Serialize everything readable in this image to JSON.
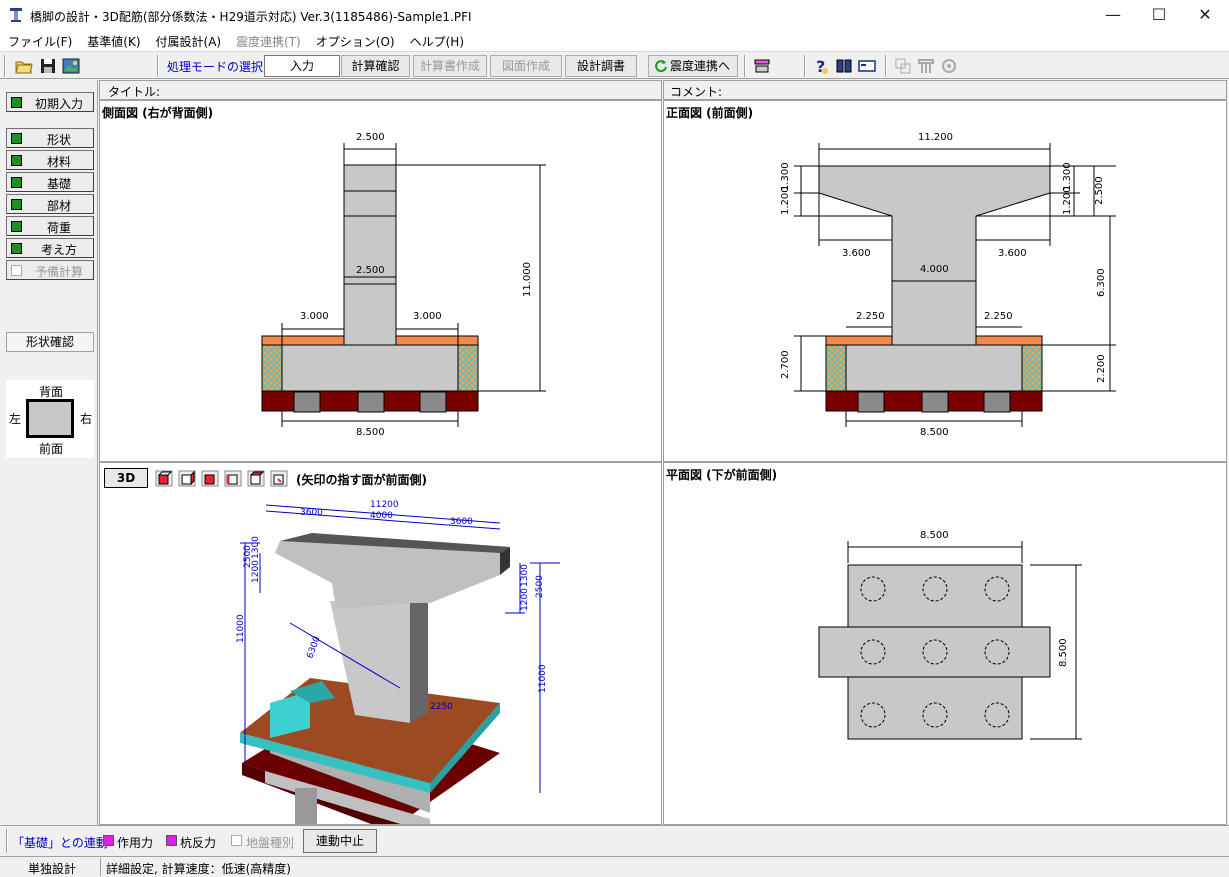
{
  "window": {
    "title": "橋脚の設計・3D配筋(部分係数法・H29道示対応) Ver.3(1185486)-Sample1.PFI",
    "minimize": "—",
    "maximize": "☐",
    "close": "✕"
  },
  "menu": [
    {
      "label": "ファイル(F)",
      "enabled": true
    },
    {
      "label": "基準値(K)",
      "enabled": true
    },
    {
      "label": "付属設計(A)",
      "enabled": true
    },
    {
      "label": "震度連携(T)",
      "enabled": false
    },
    {
      "label": "オプション(O)",
      "enabled": true
    },
    {
      "label": "ヘルプ(H)",
      "enabled": true
    }
  ],
  "toolbar": {
    "mode_label": "処理モードの選択",
    "input": "入力",
    "calc_check": "計算確認",
    "calc_doc": "計算書作成",
    "drawing": "図面作成",
    "design_doc": "設計調書",
    "seismic_link": "震度連携へ"
  },
  "sidebar": {
    "items": [
      {
        "label": "初期入力",
        "checked": true,
        "enabled": true
      },
      {
        "label": "形状",
        "checked": true,
        "enabled": true
      },
      {
        "label": "材料",
        "checked": true,
        "enabled": true
      },
      {
        "label": "基礎",
        "checked": true,
        "enabled": true
      },
      {
        "label": "部材",
        "checked": true,
        "enabled": true
      },
      {
        "label": "荷重",
        "checked": true,
        "enabled": true
      },
      {
        "label": "考え方",
        "checked": true,
        "enabled": true
      },
      {
        "label": "予備計算",
        "checked": false,
        "enabled": false
      }
    ],
    "shape_check": "形状確認",
    "orient": {
      "back": "背面",
      "left": "左",
      "right": "右",
      "front": "前面"
    }
  },
  "header": {
    "title_label": "タイトル:",
    "comment_label": "コメント:"
  },
  "side_view": {
    "title": "側面図 (右が背面側)",
    "dims": {
      "top_width": "2.500",
      "col_width": "2.500",
      "left": "3.000",
      "right": "3.000",
      "base": "8.500",
      "height": "11.000"
    }
  },
  "front_view": {
    "title": "正面図 (前面側)",
    "dims": {
      "beam": "11.200",
      "h1": "1.300",
      "h2": "1.200",
      "h3": "2.500",
      "cant_l": "3.600",
      "cant_r": "3.600",
      "col": "4.000",
      "col_h": "6.300",
      "ftg_l": "2.250",
      "ftg_r": "2.250",
      "ftg_h1": "2.700",
      "ftg_h2": "2.200",
      "base": "8.500",
      "h1r": "1.300",
      "h2r": "1.200"
    }
  },
  "view3d": {
    "button": "3D",
    "caption": "(矢印の指す面が前面側)",
    "dims": {
      "total": "11200",
      "l": "3600",
      "m": "4000",
      "r": "3600",
      "h1": "1300",
      "h2": "1200",
      "h3": "2500",
      "hl1": "2500",
      "hl2": "1200",
      "hl3": "1300",
      "total_h": "11000",
      "col_h": "11000",
      "c1": "6300",
      "c2": "2250"
    }
  },
  "plan_view": {
    "title": "平面図 (下が前面側)",
    "dims": {
      "width": "8.500",
      "depth": "8.500"
    }
  },
  "link_bar": {
    "label": "「基礎」との連動",
    "force": "作用力",
    "pile": "杭反力",
    "ground": "地盤種別",
    "stop": "連動中止"
  },
  "status": {
    "mode": "単独設計",
    "detail": "詳細設定, 計算速度：低速(高精度)"
  },
  "colors": {
    "concrete": "#c8c8c8",
    "footing_top": "#f28a4e",
    "base_slab": "#7a0000",
    "hatch": "#40c8c8",
    "dim": "#000000",
    "dim3d": "#0000c8"
  }
}
